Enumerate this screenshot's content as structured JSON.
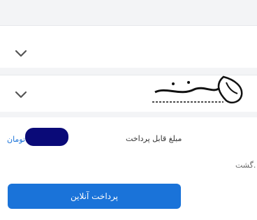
{
  "dropdowns": [
    {
      "icon": "chevron-down-icon"
    },
    {
      "icon": "chevron-down-icon"
    }
  ],
  "watermark": {
    "title": "همراه مشاور",
    "subtitle": "بزرگترین سامانه مشاوره تلفنی کشور"
  },
  "payment": {
    "currency": "تومان",
    "amount_label": "مبلغ قابل پرداخت"
  },
  "note_text": "گشت.",
  "pay_button_label": "پرداخت آنلاین",
  "colors": {
    "accent": "#1a73d9",
    "redaction": "#0a0a78",
    "band": "#f3f4f6"
  }
}
